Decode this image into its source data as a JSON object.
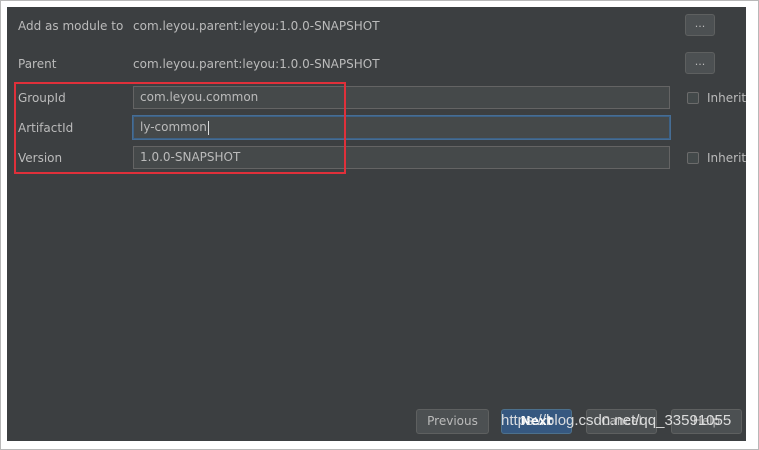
{
  "form": {
    "add_as_module_to": {
      "label": "Add as module to",
      "value": "com.leyou.parent:leyou:1.0.0-SNAPSHOT",
      "browse_label": "..."
    },
    "parent": {
      "label": "Parent",
      "value": "com.leyou.parent:leyou:1.0.0-SNAPSHOT",
      "browse_label": "..."
    },
    "group_id": {
      "label": "GroupId",
      "value": "com.leyou.common",
      "inherit_label": "Inherit",
      "inherit_checked": false
    },
    "artifact_id": {
      "label": "ArtifactId",
      "value": "ly-common",
      "focused": true
    },
    "version": {
      "label": "Version",
      "value": "1.0.0-SNAPSHOT",
      "inherit_label": "Inherit",
      "inherit_checked": false
    }
  },
  "buttons": {
    "previous": "Previous",
    "next": "Next",
    "cancel": "Cancel",
    "help": "Help"
  },
  "watermark": "https://blog.csdn.net/qq_33591055",
  "colors": {
    "dialog_bg": "#3c3f41",
    "text": "#bbbbbb",
    "field_bg": "#45494a",
    "focus_border": "#466d94",
    "default_button": "#365880",
    "annotation_box": "#e0303a"
  }
}
